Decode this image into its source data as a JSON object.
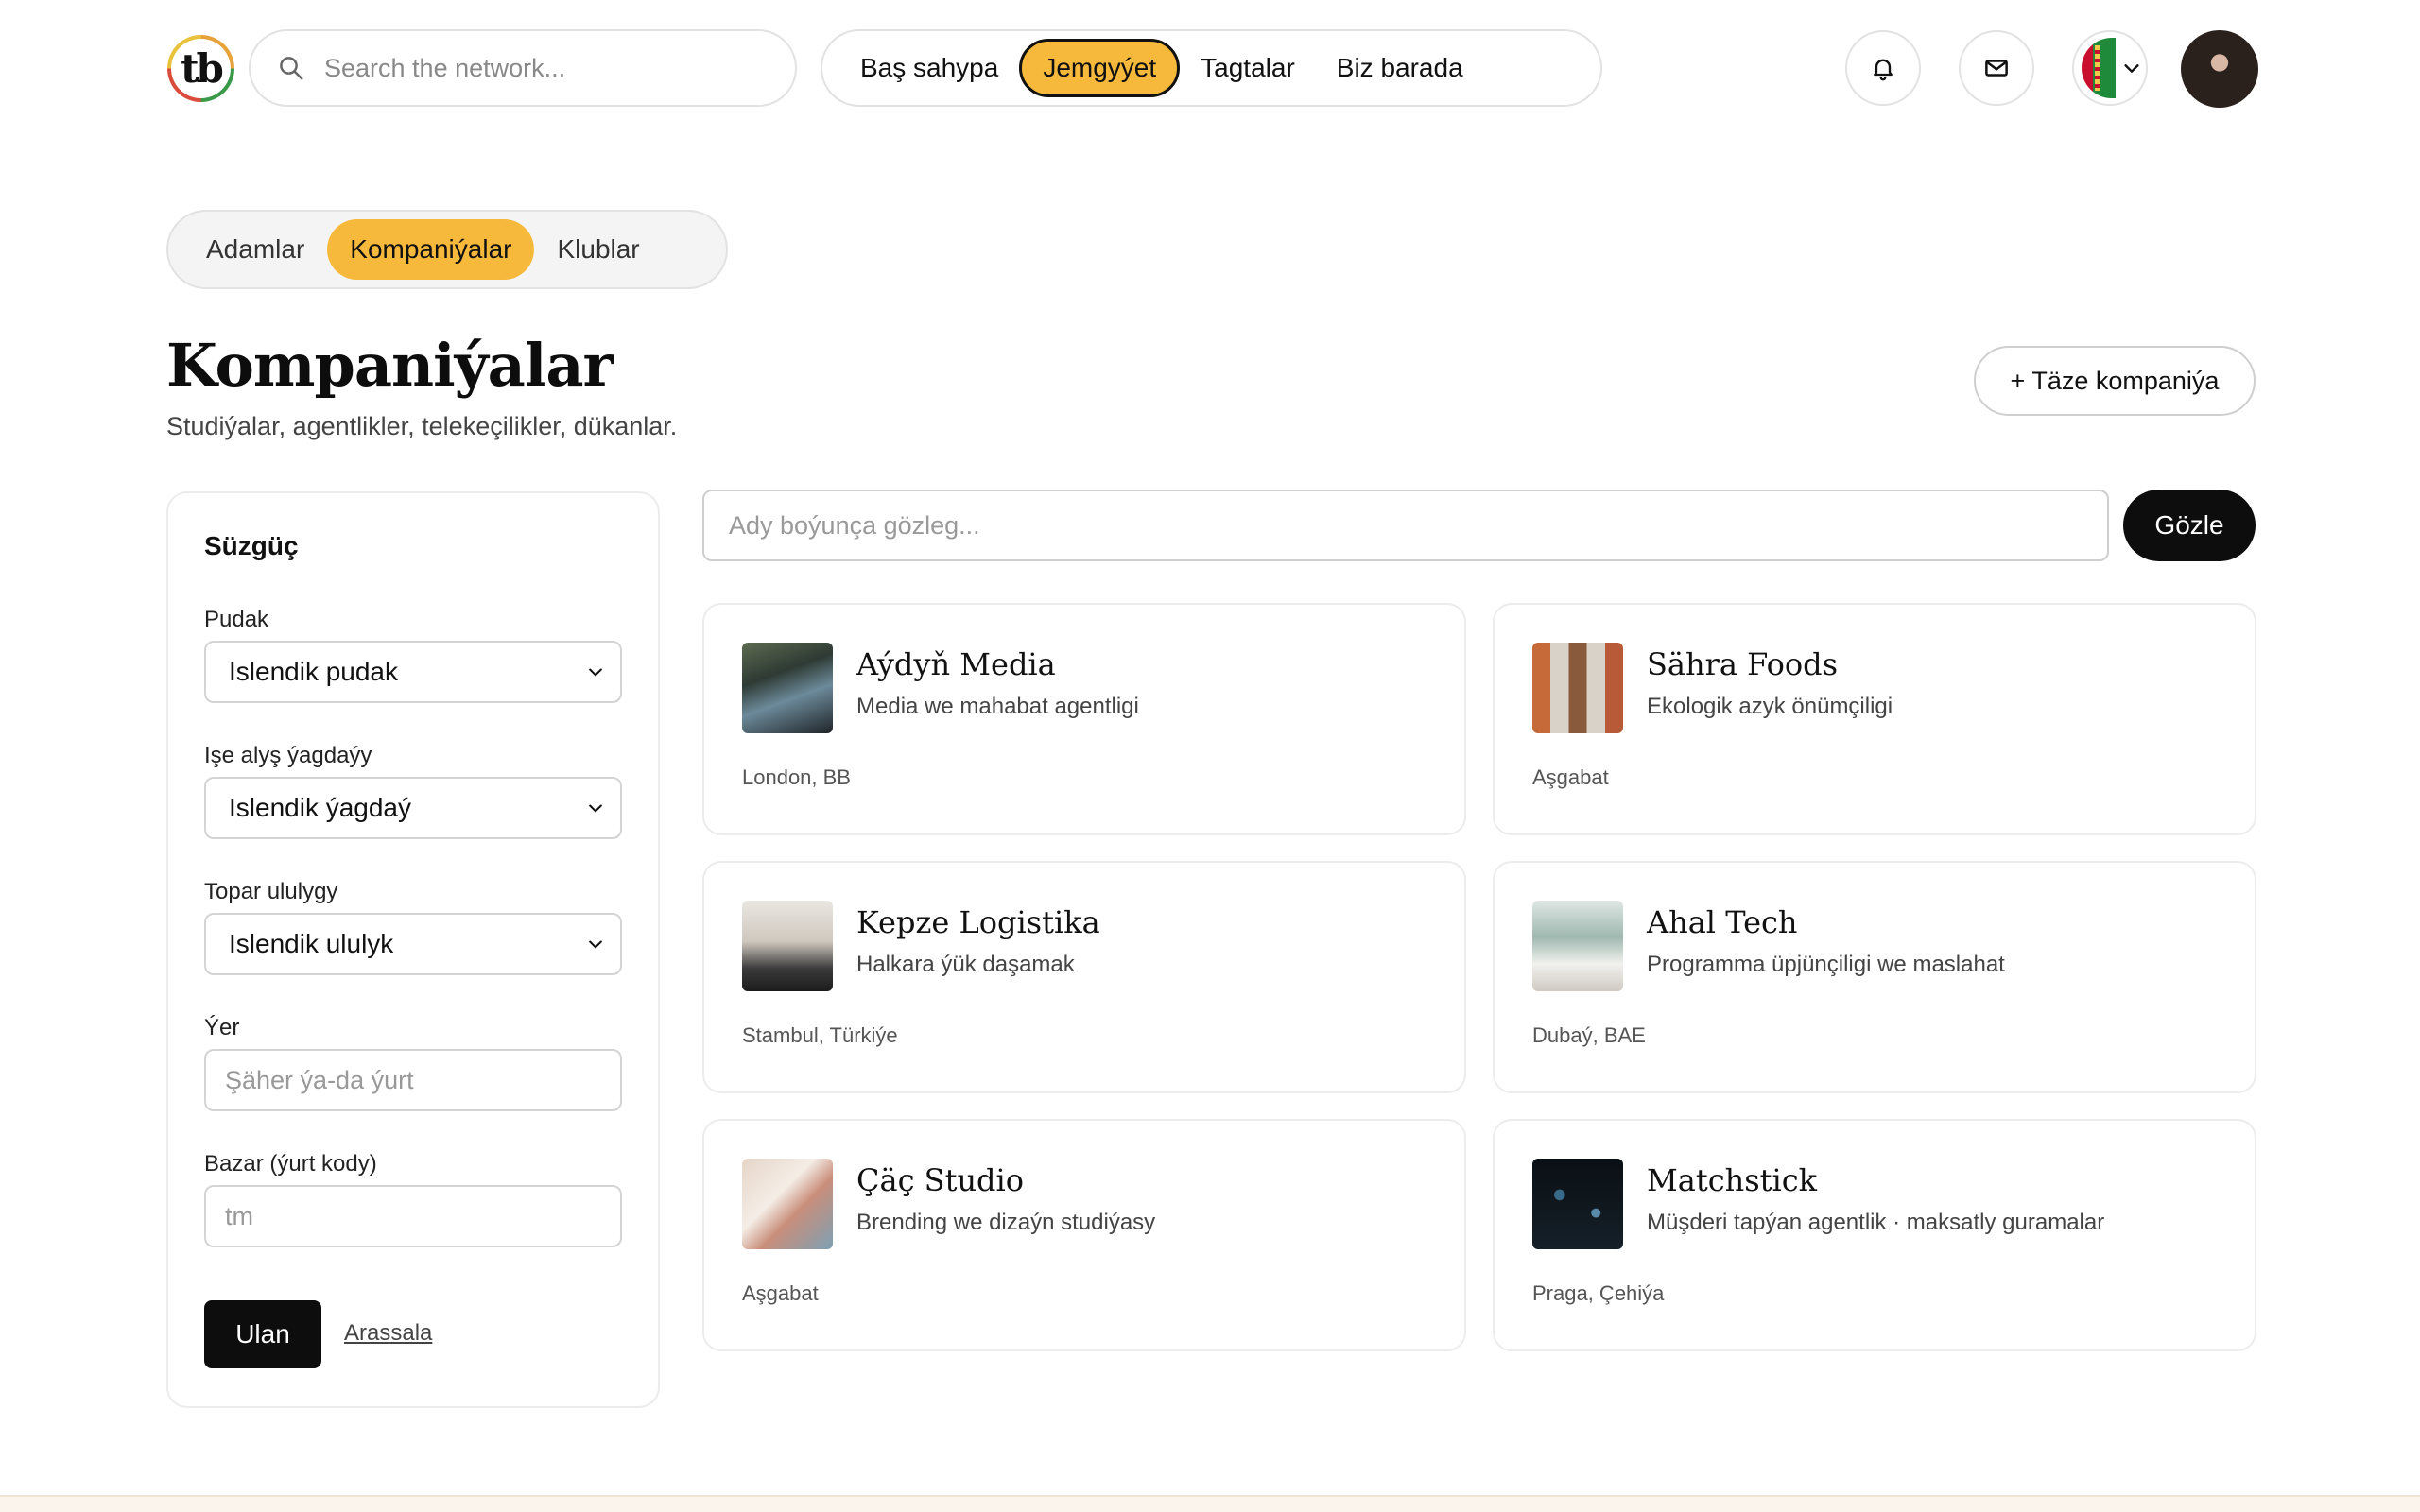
{
  "header": {
    "logo_text": "tb",
    "search_placeholder": "Search the network...",
    "nav": [
      {
        "label": "Baş sahypa",
        "active": false
      },
      {
        "label": "Jemgyýet",
        "active": true
      },
      {
        "label": "Tagtalar",
        "active": false
      },
      {
        "label": "Biz barada",
        "active": false
      }
    ],
    "icons": {
      "notifications": "bell-icon",
      "messages": "mail-icon",
      "language": "turkmenistan-flag-icon",
      "dropdown": "chevron-down-icon"
    }
  },
  "tabs": [
    {
      "label": "Adamlar",
      "active": false
    },
    {
      "label": "Kompaniýalar",
      "active": true
    },
    {
      "label": "Klublar",
      "active": false
    }
  ],
  "page": {
    "title": "Kompaniýalar",
    "subtitle": "Studiýalar, agentlikler, telekeçilikler, dükanlar.",
    "new_button": "+ Täze kompaniýa"
  },
  "filter": {
    "title": "Süzgüç",
    "industry_label": "Pudak",
    "industry_value": "Islendik pudak",
    "hiring_label": "Işe alyş ýagdaýy",
    "hiring_value": "Islendik ýagdaý",
    "size_label": "Topar ululygy",
    "size_value": "Islendik ululyk",
    "location_label": "Ýer",
    "location_placeholder": "Şäher ýa-da ýurt",
    "market_label": "Bazar (ýurt kody)",
    "market_placeholder": "tm",
    "apply": "Ulan",
    "reset": "Arassala"
  },
  "search": {
    "placeholder": "Ady boýunça gözleg...",
    "button": "Gözle"
  },
  "companies": [
    {
      "name": "Aýdyň Media",
      "description": "Media we mahabat agentligi",
      "location": "London, BB"
    },
    {
      "name": "Sähra Foods",
      "description": "Ekologik azyk önümçiligi",
      "location": "Aşgabat"
    },
    {
      "name": "Kepze Logistika",
      "description": "Halkara ýük daşamak",
      "location": "Stambul, Türkiýe"
    },
    {
      "name": "Ahal Tech",
      "description": "Programma üpjünçiligi we maslahat",
      "location": "Dubaý, BAE"
    },
    {
      "name": "Çäç Studio",
      "description": "Brending we dizaýn studiýasy",
      "location": "Aşgabat"
    },
    {
      "name": "Matchstick",
      "description": "Müşderi tapýan agentlik · maksatly guramalar",
      "location": "Praga, Çehiýa"
    }
  ],
  "colors": {
    "accent": "#f6b93b",
    "dark": "#0d0d0d",
    "border": "#e2e2e2"
  }
}
